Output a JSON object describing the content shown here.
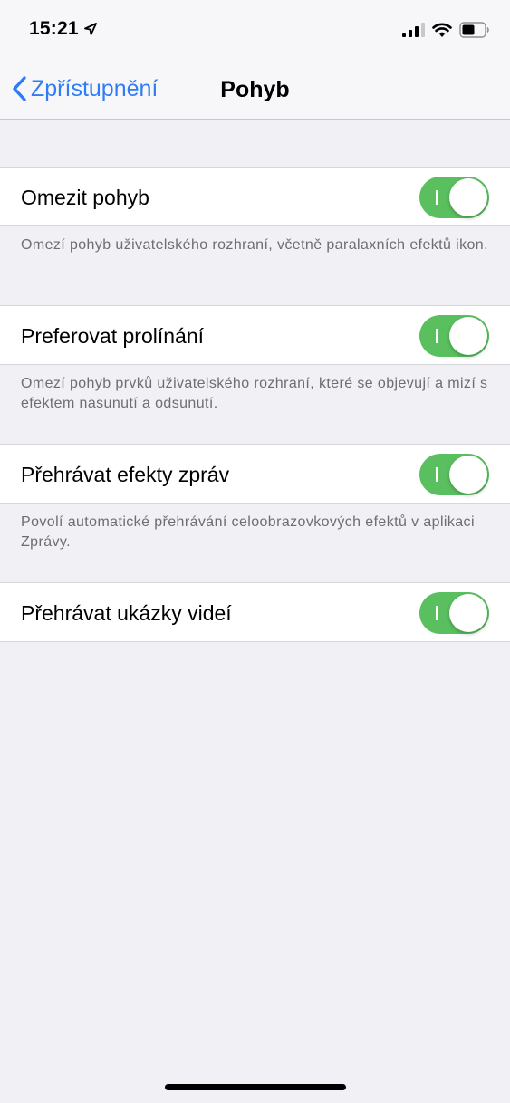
{
  "status_bar": {
    "time": "15:21",
    "icons": [
      "location-arrow-icon",
      "cellular-signal-icon",
      "wifi-icon",
      "battery-icon"
    ]
  },
  "nav": {
    "back_label": "Zpřístupnění",
    "title": "Pohyb"
  },
  "accent_color": "#2f7cf6",
  "toggle_on_color": "#5ac05f",
  "settings": [
    {
      "label": "Omezit pohyb",
      "on": true,
      "footer": "Omezí pohyb uživatelského rozhraní, včetně paralaxních efektů ikon."
    },
    {
      "label": "Preferovat prolínání",
      "on": true,
      "footer": "Omezí pohyb prvků uživatelského rozhraní, které se objevují a mizí s efektem nasunutí a odsunutí."
    },
    {
      "label": "Přehrávat efekty zpráv",
      "on": true,
      "footer": "Povolí automatické přehrávání celoobrazovkových efektů v aplikaci Zprávy."
    },
    {
      "label": "Přehrávat ukázky videí",
      "on": true,
      "footer": ""
    }
  ]
}
